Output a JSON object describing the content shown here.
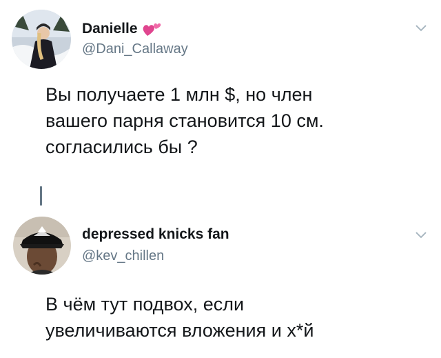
{
  "tweets": [
    {
      "display_name": "Danielle",
      "emoji": "💕",
      "handle": "@Dani_Callaway",
      "text": "Вы получаете 1 млн $, но член\nвашего парня становится 10 см.\nсогласились бы ?"
    },
    {
      "display_name": "depressed knicks fan",
      "handle": "@kev_chillen",
      "text": "В чём тут подвох, если\nувеличиваются вложения и х*й"
    }
  ],
  "icons": {
    "menu": "chevron-down-icon",
    "emoji": "two-hearts-icon"
  },
  "colors": {
    "text": "#14171a",
    "handle": "#657786",
    "chevron": "#aab8c2",
    "hearts": "#e0458f"
  }
}
